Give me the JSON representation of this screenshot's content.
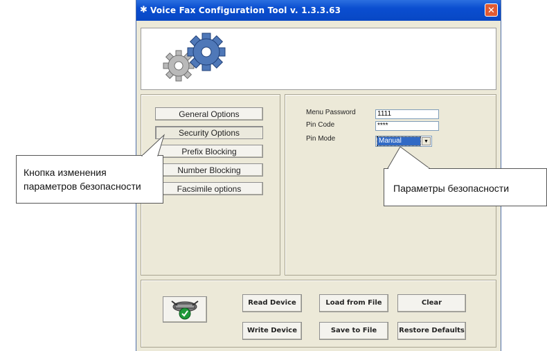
{
  "window": {
    "title": "Voice Fax Configuration Tool v. 1.3.3.63",
    "close_label": "✕"
  },
  "nav": {
    "items": [
      {
        "label": "General Options"
      },
      {
        "label": "Security Options"
      },
      {
        "label": "Prefix Blocking"
      },
      {
        "label": "Number Blocking"
      },
      {
        "label": "Facsimile options"
      }
    ],
    "active_index": 1
  },
  "security": {
    "menu_password_label": "Menu Password",
    "menu_password_value": "1111",
    "pin_code_label": "Pin Code",
    "pin_code_value": "****",
    "pin_mode_label": "Pin Mode",
    "pin_mode_value": "Manual"
  },
  "actions": {
    "read_device": "Read Device",
    "load_from_file": "Load from File",
    "clear": "Clear",
    "write_device": "Write Device",
    "save_to_file": "Save to File",
    "restore_defaults": "Restore Defaults"
  },
  "annotations": {
    "left_line1": "Кнопка изменения",
    "left_line2": "параметров безопасности",
    "right": "Параметры безопасности"
  },
  "icons": {
    "gears": "gears-icon",
    "device": "device-check-icon"
  }
}
